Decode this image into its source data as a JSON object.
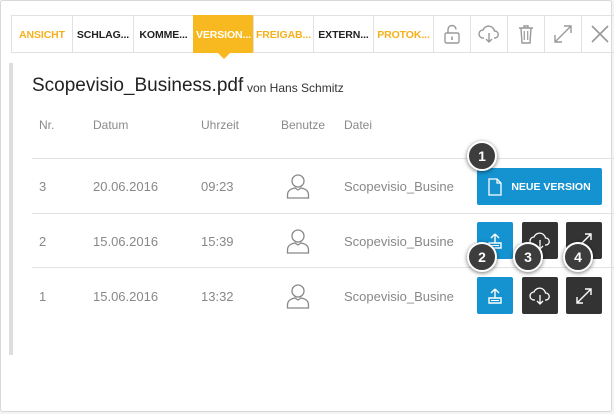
{
  "tabs": [
    {
      "label": "ANSICHT"
    },
    {
      "label": "SCHLAG..."
    },
    {
      "label": "KOMME..."
    },
    {
      "label": "VERSION..."
    },
    {
      "label": "FREIGAB..."
    },
    {
      "label": "EXTERN..."
    },
    {
      "label": "PROTOK..."
    }
  ],
  "toolbar_icons": [
    "unlock-icon",
    "cloud-download-icon",
    "trash-icon",
    "expand-icon",
    "close-icon"
  ],
  "document": {
    "title": "Scopevisio_Business.pdf",
    "subtitle": "von Hans Schmitz"
  },
  "table": {
    "columns": [
      "Nr.",
      "Datum",
      "Uhrzeit",
      "Benutze",
      "Datei"
    ],
    "rows": [
      {
        "nr": "3",
        "datum": "20.06.2016",
        "uhrzeit": "09:23",
        "datei": "Scopevisio_Busine"
      },
      {
        "nr": "2",
        "datum": "15.06.2016",
        "uhrzeit": "15:39",
        "datei": "Scopevisio_Busine"
      },
      {
        "nr": "1",
        "datum": "15.06.2016",
        "uhrzeit": "13:32",
        "datei": "Scopevisio_Busine"
      }
    ]
  },
  "new_version_button": {
    "label": "NEUE VERSION"
  },
  "callouts": [
    "1",
    "2",
    "3",
    "4"
  ],
  "colors": {
    "accent": "#f8b820",
    "primary": "#1593d0",
    "dark": "#333333"
  }
}
